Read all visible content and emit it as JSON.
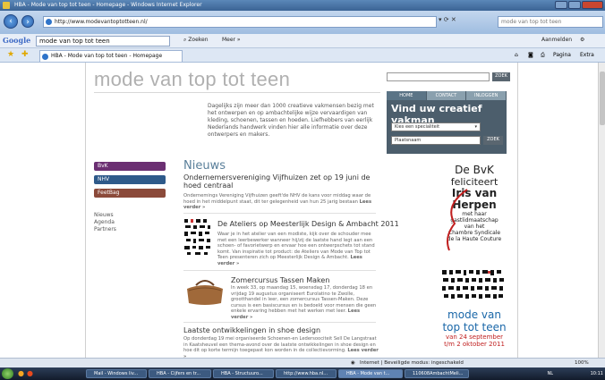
{
  "window": {
    "title": "HBA - Mode van top tot teen - Homepage - Windows Internet Explorer"
  },
  "browser": {
    "address": "http://www.modevantoptotteen.nl/",
    "search_placeholder": "mode van top tot teen",
    "google_query": "mode van top tot teen",
    "google_logo": "Google",
    "zoeken": "Zoeken",
    "meer": "Meer »",
    "aanmelden": "Aanmelden",
    "tab_title": "HBA - Mode van top tot teen - Homepage",
    "pagina": "Pagina",
    "extra": "Extra"
  },
  "page": {
    "logo": "mode van top tot teen",
    "intro": "Dagelijks zijn meer dan 1000 creatieve vakmensen bezig met het ontwerpen en op ambachtelijke wijze vervaardigen van kleding, schoenen, tassen en hoeden. Liefhebbers van eerlijk Nederlands handwerk vinden hier alle informatie over deze ontwerpers en makers.",
    "zoek": "ZOEK",
    "panel_tabs": [
      "HOME",
      "CONTACT",
      "INLOGGEN"
    ],
    "panel_title": "Vind uw creatief vakman",
    "specialist_select": "Kies een specialiteit",
    "plaats_placeholder": "Plaatsnaam",
    "nav_pills": [
      {
        "label": "BvK",
        "color": "#6b2f72"
      },
      {
        "label": "NHV",
        "color": "#2e5a8a"
      },
      {
        "label": "FeetBag",
        "color": "#8b4a3a"
      }
    ],
    "side_links": [
      "Nieuws",
      "Agenda",
      "Partners"
    ],
    "news_heading": "Nieuws",
    "articles": [
      {
        "title": "Ondernemersvereniging Vijfhuizen zet op 19 juni de hoed centraal",
        "body": "Ondernemings Vereniging Vijfhuizen geeft'de NHV de kans voor middag waar de hoed in het middelpunt staat, dit ter gelegenheid van hun 25 jarig bestaan",
        "more": "Lees verder »"
      },
      {
        "title": "De Ateliers op Meesterlijk Design & Ambacht 2011",
        "body": "Waar je in het atelier van een modiste, kijk over de schouder mee met een leerbewerker wanneer hij/zij de laatste hand legt aan een schoen- of favorietwerp en ervaar hoe een ontwerpschets tot stand komt. Van inspiratie tot product: de Ateliers van Mode van Top tot Teen presenteren zich op Meesterlijk Design & Ambacht.",
        "more": "Lees verder »"
      },
      {
        "title": "Zomercursus Tassen Maken",
        "body": "In week 33, op maandag 15, woensdag 17, donderdag 18 en vrijdag 19 augustus organiseert Eurolatino te Zwolle, grootthandel in leer, een zomercursus Tassen-Maken. Deze cursus is een basiscursus en is bedoeld voor mensen die geen enkele ervaring hebben met het werken met leer.",
        "more": "Lees verder »"
      },
      {
        "title": "Laatste ontwikkelingen in shoe design",
        "body": "Op donderdag 19 mei organiseerde Schoenen-en Ledersoociteit Sell De Langstraat in Kaatsheuvel een thema-avond over de laatste ontwikkelingen in shoe design en hoe dit op korte termijn toegepast kon worden in de collectievorming.",
        "more": "Lees verder »"
      }
    ],
    "ad1": {
      "line1": "De BvK",
      "line2": "feliciteert",
      "name": "Iris van Herpen",
      "line3": "met haar",
      "line4": "gastlidmaatschap",
      "line5": "van het",
      "line6": "Chambre Syndicale",
      "line7": "de la Haute Couture"
    },
    "ad2": {
      "line1": "mode van",
      "line2": "top tot teen",
      "line3": "van 24 september",
      "line4": "t/m 2 oktober 2011"
    }
  },
  "status": {
    "zone": "Internet | Beveiligde modus: ingeschakeld",
    "zoom": "100%"
  },
  "taskbar": {
    "items": [
      "Mail - Windows liv...",
      "HBA - Cijfers en tr...",
      "HBA - Structuuro...",
      "http://www.hba.nl...",
      "HBA - Mode van t...",
      "110608AmbachtMeli..."
    ],
    "lang": "NL",
    "time": "10:11"
  }
}
